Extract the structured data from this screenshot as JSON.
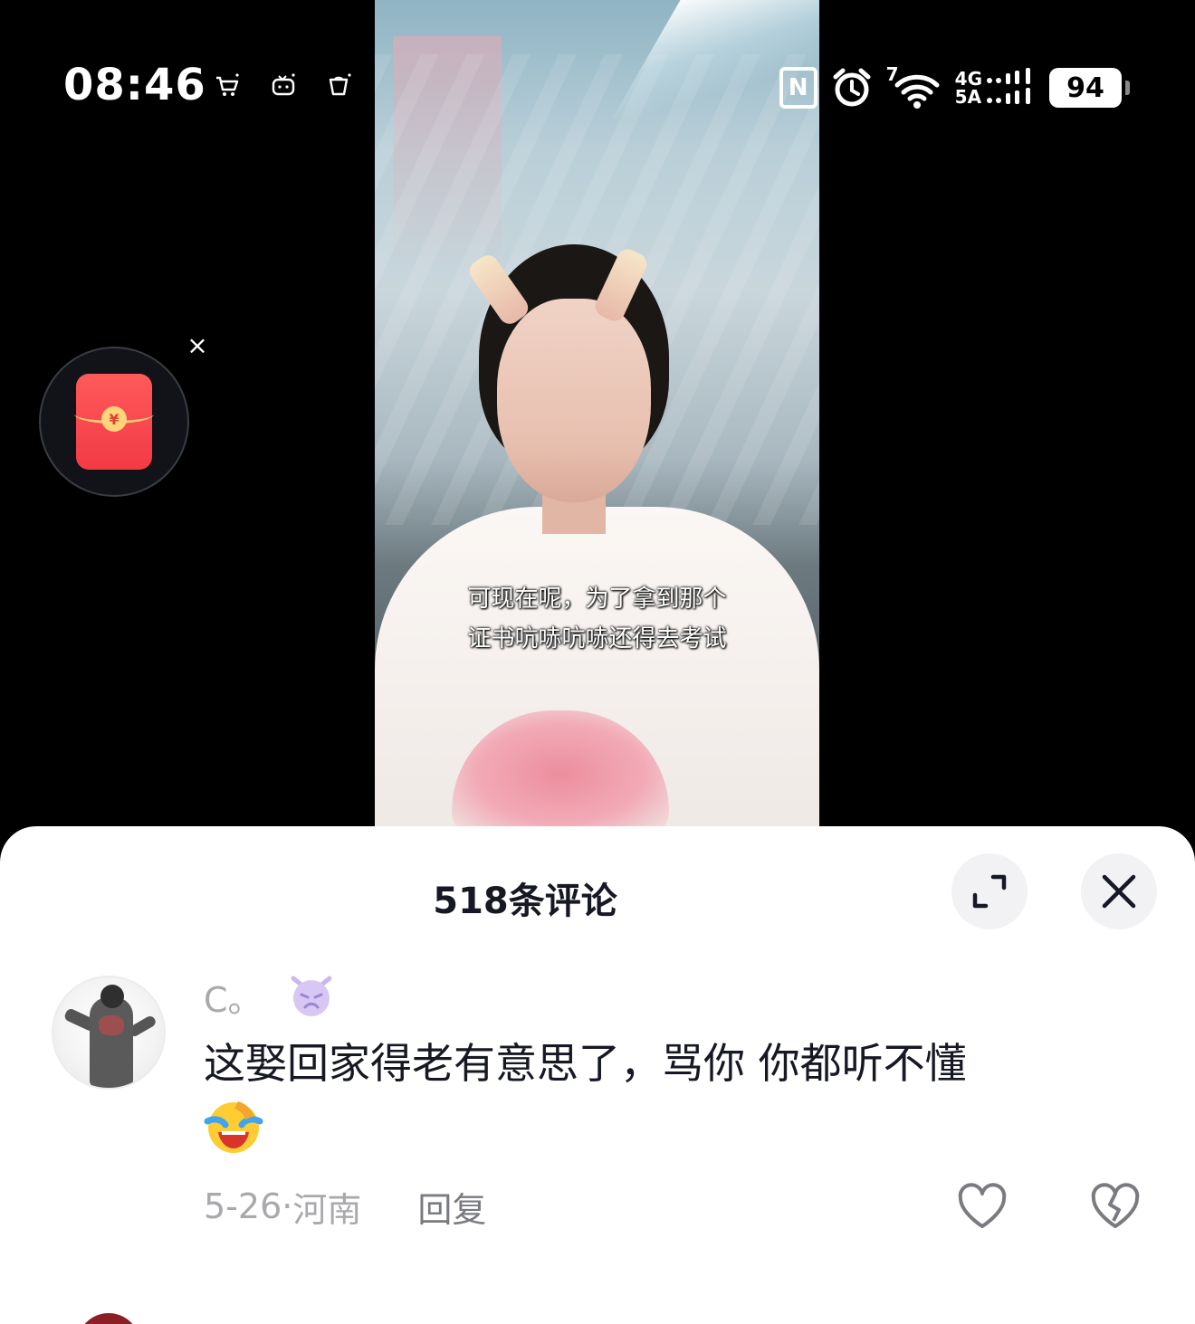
{
  "status_bar": {
    "time": "08:46",
    "left_icons": [
      "shopping-cart-icon",
      "tv-icon",
      "cup-icon"
    ],
    "nfc_label": "N",
    "signal_primary": "7",
    "network_line1": "4G",
    "network_line2": "5A",
    "battery": "94"
  },
  "video": {
    "subtitle_line1": "可现在呢，为了拿到那个",
    "subtitle_line2": "证书吭哧吭哧还得去考试"
  },
  "red_packet": {
    "coin_symbol": "¥",
    "close_label": "×"
  },
  "comments_sheet": {
    "title": "518条评论",
    "expand_icon": "expand-icon",
    "close_icon": "close-icon"
  },
  "comments": [
    {
      "username": "C。",
      "badge_icon": "devil-emoji-icon",
      "text": "这娶回家得老有意思了，骂你  你都听不懂",
      "trailing_emoji": "laughing-crying-emoji",
      "date": "5-26",
      "separator": "·",
      "location": "河南",
      "reply_label": "回复"
    }
  ],
  "colors": {
    "sheet_bg": "#ffffff",
    "title_text": "#161823",
    "meta_text": "#a9a9ad",
    "red_packet": "#f23a45"
  }
}
